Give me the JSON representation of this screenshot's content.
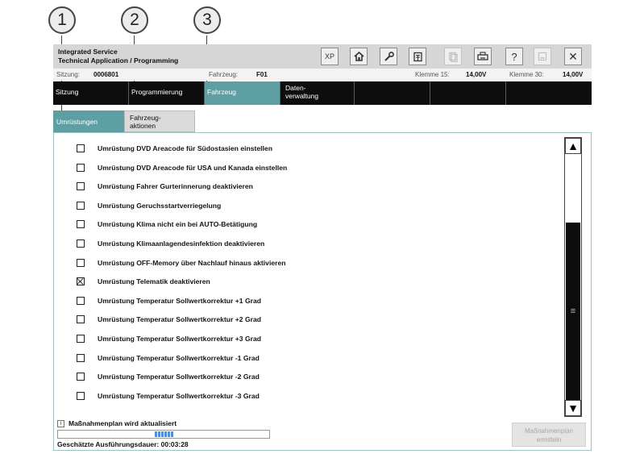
{
  "callouts": [
    "1",
    "2",
    "3"
  ],
  "app": {
    "title_line1": "Integrated Service",
    "title_line2": "Technical Application / Programming"
  },
  "toolbar": {
    "xp_label": "XP",
    "home_icon": "home-icon",
    "wrench_icon": "wrench-icon",
    "document_icon": "document-icon",
    "copy_icon": "copy-icon",
    "printer_icon": "printer-icon",
    "help_label": "?",
    "minimize_icon": "minimize-icon",
    "close_label": "✕"
  },
  "infobar": {
    "sitzung_label": "Sitzung:",
    "sitzung_value": "0006801",
    "fahrzeug_label": "Fahrzeug:",
    "fahrzeug_value": "F01",
    "klemme15_label": "Klemme 15:",
    "klemme15_value": "14,00V",
    "klemme30_label": "Klemme 30:",
    "klemme30_value": "14,00V"
  },
  "mainnav": {
    "tabs": [
      {
        "label": "Sitzung"
      },
      {
        "label": "Programmierung"
      },
      {
        "label": "Fahrzeug"
      },
      {
        "label_line1": "Daten-",
        "label_line2": "verwaltung"
      }
    ],
    "active": "Fahrzeug"
  },
  "subnav": {
    "active_label": "Umrüstungen",
    "inactive_line1": "Fahrzeug-",
    "inactive_line2": "aktionen"
  },
  "list": {
    "items": [
      {
        "label": "Umrüstung DVD Areacode für Südostasien einstellen",
        "checked": false
      },
      {
        "label": "Umrüstung DVD Areacode für USA und Kanada einstellen",
        "checked": false
      },
      {
        "label": "Umrüstung Fahrer Gurterinnerung deaktivieren",
        "checked": false
      },
      {
        "label": "Umrüstung Geruchsstartverriegelung",
        "checked": false
      },
      {
        "label": "Umrüstung Klima nicht ein bei AUTO-Betätigung",
        "checked": false
      },
      {
        "label": "Umrüstung Klimaanlagendesinfektion deaktivieren",
        "checked": false
      },
      {
        "label": "Umrüstung OFF-Memory über Nachlauf hinaus aktivieren",
        "checked": false
      },
      {
        "label": "Umrüstung Telematik deaktivieren",
        "checked": true
      },
      {
        "label": "Umrüstung Temperatur Sollwertkorrektur +1 Grad",
        "checked": false
      },
      {
        "label": "Umrüstung Temperatur Sollwertkorrektur +2 Grad",
        "checked": false
      },
      {
        "label": "Umrüstung Temperatur Sollwertkorrektur +3 Grad",
        "checked": false
      },
      {
        "label": "Umrüstung Temperatur Sollwertkorrektur -1 Grad",
        "checked": false
      },
      {
        "label": "Umrüstung Temperatur Sollwertkorrektur -2 Grad",
        "checked": false
      },
      {
        "label": "Umrüstung Temperatur Sollwertkorrektur -3 Grad",
        "checked": false
      }
    ]
  },
  "scrollbar": {
    "up_glyph": "▲",
    "down_glyph": "▼",
    "grip_glyph": "≡"
  },
  "footer": {
    "info_glyph": "i",
    "status_text": "Maßnahmenplan wird aktualisiert",
    "duration_text": "Geschätzte Ausführungsdauer: 00:03:28",
    "button_line1": "Maßnahmenplan",
    "button_line2": "ermitteln"
  }
}
